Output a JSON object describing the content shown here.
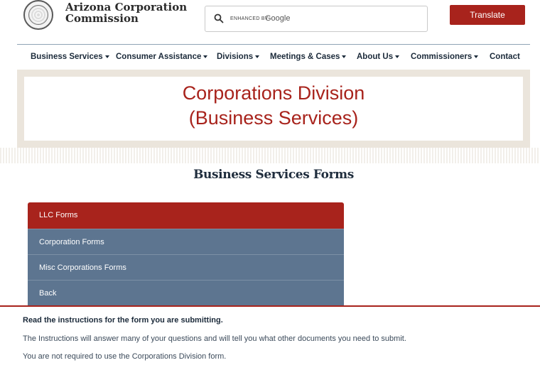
{
  "header": {
    "brand_line1": "Arizona Corporation",
    "brand_line2": "Commission",
    "search": {
      "enhanced_by": "ENHANCED BY",
      "google": "Google",
      "placeholder": ""
    },
    "translate_label": "Translate"
  },
  "nav": {
    "items": [
      {
        "label": "Business Services",
        "dropdown": true
      },
      {
        "label": "Consumer Assistance",
        "dropdown": true
      },
      {
        "label": "Divisions",
        "dropdown": true
      },
      {
        "label": "Meetings & Cases",
        "dropdown": true
      },
      {
        "label": "About Us",
        "dropdown": true
      },
      {
        "label": "Commissioners",
        "dropdown": true
      },
      {
        "label": "Contact",
        "dropdown": false
      }
    ]
  },
  "hero": {
    "title_line1": "Corporations Division",
    "title_line2": "(Business Services)"
  },
  "section_title": "Business Services Forms",
  "menu": {
    "items": [
      {
        "label": "LLC Forms",
        "active": true
      },
      {
        "label": "Corporation Forms",
        "active": false
      },
      {
        "label": "Misc Corporations Forms",
        "active": false
      },
      {
        "label": "Back",
        "active": false
      }
    ]
  },
  "info": {
    "heading": "Read the instructions for the form you are submitting.",
    "line1": "The Instructions will answer many of your questions and will tell you what other documents you need to submit.",
    "line2": "You are not required to use the Corporations Division form."
  },
  "colors": {
    "accent": "#a8231c",
    "menu_bg": "#5d7590",
    "hero_frame": "#ebe5dc",
    "nav_text": "#1b2a3a"
  }
}
